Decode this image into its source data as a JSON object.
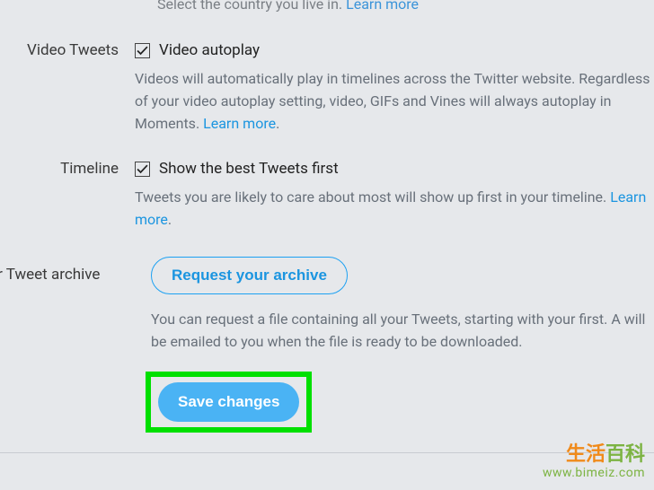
{
  "top_line": {
    "text": "Select the country you live in.",
    "link": "Learn more"
  },
  "sections": {
    "video_tweets": {
      "label": "Video Tweets",
      "checkbox_label": "Video autoplay",
      "desc": "Videos will automatically play in timelines across the Twitter website. Regardless of your video autoplay setting, video, GIFs and Vines will always autoplay in Moments.",
      "link": "Learn more"
    },
    "timeline": {
      "label": "Timeline",
      "checkbox_label": "Show the best Tweets first",
      "desc": "Tweets you are likely to care about most will show up first in your timeline.",
      "link": "Learn more"
    },
    "archive": {
      "label": "our Tweet archive",
      "button": "Request your archive",
      "desc": "You can request a file containing all your Tweets, starting with your first. A will be emailed to you when the file is ready to be downloaded."
    }
  },
  "save_button": "Save changes",
  "watermark": {
    "brand": "生活百科",
    "url": "www.bimeiz.com"
  }
}
